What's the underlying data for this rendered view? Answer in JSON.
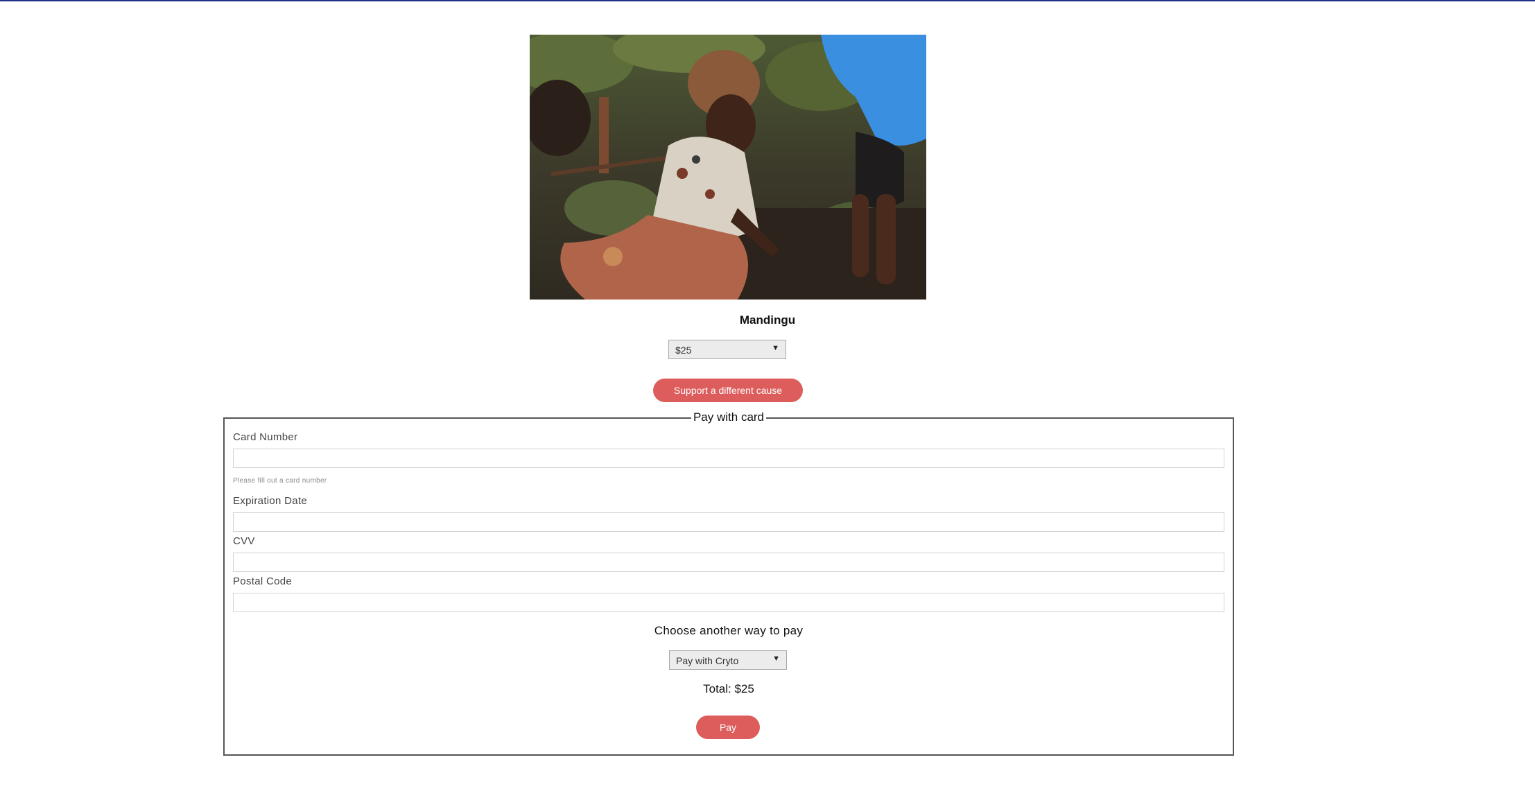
{
  "colors": {
    "accent": "#dd5d5d",
    "top_rule": "#1d2f87",
    "border": "#555555"
  },
  "cause": {
    "name": "Mandingu"
  },
  "amount_select": {
    "selected": "$25"
  },
  "support_different_label": "Support a different cause",
  "card_form": {
    "legend": "Pay with card",
    "card_number_label": "Card Number",
    "card_number_value": "",
    "card_number_hint": "Please fill out a card number",
    "expiration_label": "Expiration Date",
    "expiration_value": "",
    "cvv_label": "CVV",
    "cvv_value": "",
    "postal_label": "Postal Code",
    "postal_value": "",
    "alt_pay_title": "Choose another way to pay",
    "alt_pay_select": "Pay with Cryto",
    "total": "Total: $25",
    "pay_label": "Pay"
  }
}
